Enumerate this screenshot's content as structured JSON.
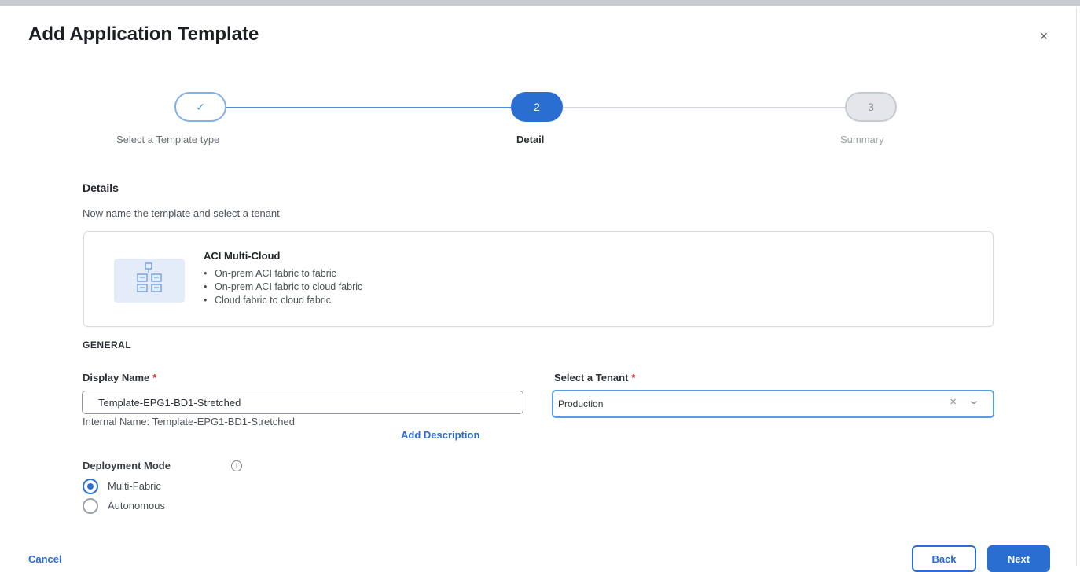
{
  "dialog": {
    "title": "Add Application Template",
    "close_label": "×"
  },
  "stepper": {
    "steps": [
      {
        "marker": "✓",
        "label": "Select a Template type",
        "state": "done"
      },
      {
        "marker": "2",
        "label": "Detail",
        "state": "active"
      },
      {
        "marker": "3",
        "label": "Summary",
        "state": "todo"
      }
    ]
  },
  "details": {
    "heading": "Details",
    "subtitle": "Now name the template and select a tenant"
  },
  "template_card": {
    "title": "ACI Multi-Cloud",
    "bullets": [
      "On-prem ACI fabric to fabric",
      "On-prem ACI fabric to cloud fabric",
      "Cloud fabric to cloud fabric"
    ]
  },
  "general": {
    "heading": "GENERAL",
    "display_name": {
      "label": "Display Name",
      "required_mark": "*",
      "value": "Template-EPG1-BD1-Stretched"
    },
    "internal_name": "Internal Name: Template-EPG1-BD1-Stretched",
    "add_description": "Add Description",
    "tenant": {
      "label": "Select a Tenant",
      "required_mark": "*",
      "value": "Production",
      "clear_label": "×",
      "caret_label": "⌄"
    }
  },
  "deployment": {
    "label": "Deployment Mode",
    "info_icon": "i",
    "options": [
      {
        "label": "Multi-Fabric",
        "checked": true
      },
      {
        "label": "Autonomous",
        "checked": false
      }
    ]
  },
  "footer": {
    "cancel": "Cancel",
    "back": "Back",
    "next": "Next"
  },
  "colors": {
    "accent": "#2b6ed1",
    "required": "#d12a2a"
  }
}
